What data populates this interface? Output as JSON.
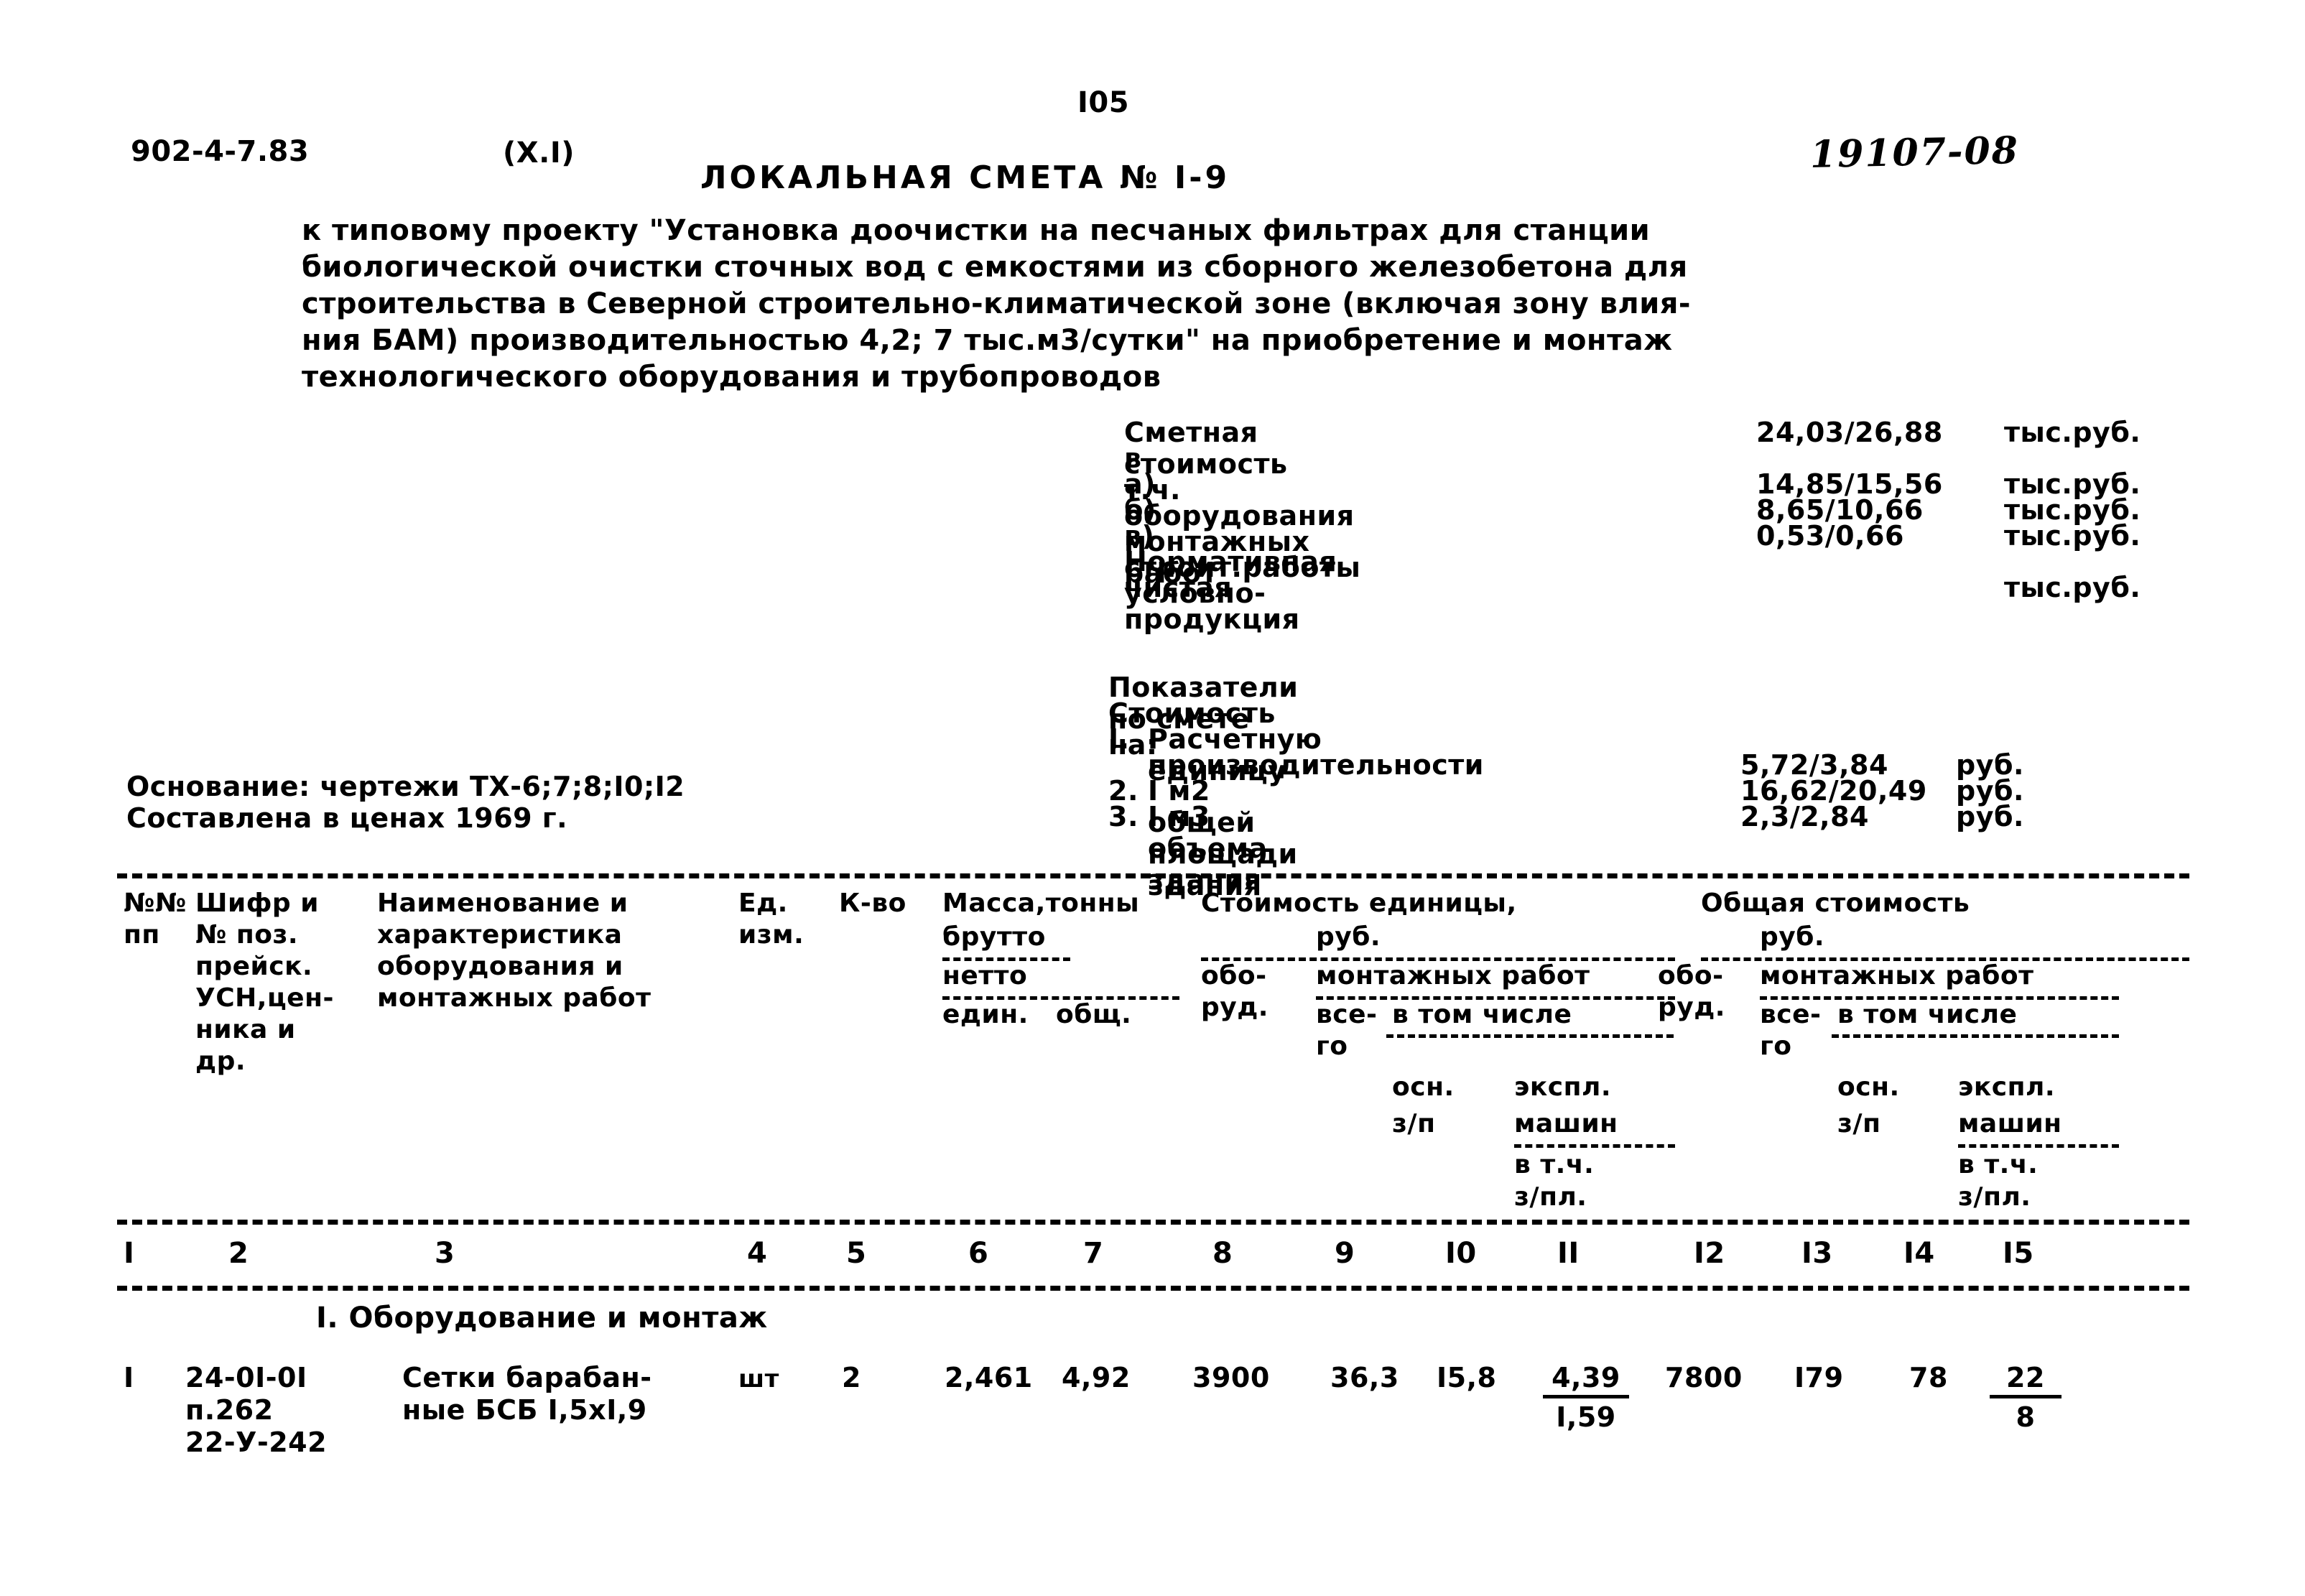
{
  "header": {
    "doc_code": "902-4-7.83",
    "variant": "(X.I)",
    "page_number": "I05",
    "title": "ЛОКАЛЬНАЯ СМЕТА № I-9",
    "archive_code": "19107-08"
  },
  "description": "к типовому проекту \"Установка доочистки на песчаных фильтрах для станции\nбиологической очистки сточных вод с емкостями из сборного железобетона для\nстроительства в Северной строительно-климатической зоне (включая зону влия-\nния БАМ) производительностью 4,2; 7 тыс.м3/сутки\" на приобретение и монтаж\nтехнологического оборудования и трубопроводов",
  "summary": {
    "total_label": "Сметная стоимость",
    "total_value": "24,03/26,88",
    "total_unit": "тыс.руб.",
    "including_label": "в т.ч.",
    "items": [
      {
        "label": "а) оборудования",
        "value": "14,85/15,56",
        "unit": "тыс.руб."
      },
      {
        "label": "б) монтажных работ",
        "value": "8,65/10,66",
        "unit": "тыс.руб."
      },
      {
        "label": "в) строит.работы",
        "value": "0,53/0,66",
        "unit": "тыс.руб."
      }
    ],
    "npp_label_1": "Нормативная условно-",
    "npp_label_2": "чистая продукция",
    "npp_value": "",
    "npp_unit": "тыс.руб."
  },
  "indicators": {
    "heading": "Показатели по смете",
    "subheading": "Стоимость на:",
    "rows": [
      {
        "num": "I.",
        "label": "Расчетную единицу",
        "label2": "производительности",
        "value": "5,72/3,84",
        "unit": "руб."
      },
      {
        "num": "2.",
        "label": "I м2 общей площади здания",
        "label2": "",
        "value": "16,62/20,49",
        "unit": "руб."
      },
      {
        "num": "3.",
        "label": "I м3 объема здания",
        "label2": "",
        "value": "2,3/2,84",
        "unit": "руб."
      }
    ]
  },
  "basis": {
    "line1": "Основание: чертежи ТХ-6;7;8;I0;I2",
    "line2": "Составлена в ценах 1969 г."
  },
  "table": {
    "headers": {
      "c1": "№№\nпп",
      "c2": "Шифр и\n№ поз.\nпрейск.\nУСН,цен-\nника и\nдр.",
      "c3": "Наименование и\nхарактеристика\nоборудования и\nмонтажных работ",
      "c4": "Ед.\nизм.",
      "c5": "К-во",
      "mass_title": "Масса,тонны",
      "mass_brutto": "брутто",
      "mass_netto": "нетто",
      "mass_edin": "един.",
      "mass_obsh": "общ.",
      "unit_cost_title": "Стоимость единицы,",
      "unit_cost_rub": "руб.",
      "unit_cost_oborud": "обо-\nруд.",
      "unit_cost_montazh": "монтажных работ",
      "unit_cost_vsego": "все-\nго",
      "unit_cost_vtomchisle": "в том числе",
      "unit_cost_osn": "осн.",
      "unit_cost_zp": "з/п",
      "unit_cost_ekspl": "экспл.",
      "unit_cost_mashin": "машин",
      "unit_cost_vtch": "в т.ч.",
      "unit_cost_zpl": "з/пл.",
      "total_cost_title": "Общая стоимость",
      "total_cost_rub": "руб.",
      "total_cost_oborud": "обо-\nруд.",
      "total_cost_montazh": "монтажных работ",
      "total_cost_vsego": "все-\nго",
      "total_cost_vtomchisle": "в том числе",
      "total_cost_osn": "осн.",
      "total_cost_zp": "з/п",
      "total_cost_ekspl": "экспл.",
      "total_cost_mashin": "машин",
      "total_cost_vtch": "в т.ч.",
      "total_cost_zpl": "з/пл."
    },
    "column_numbers": [
      "I",
      "2",
      "3",
      "4",
      "5",
      "6",
      "7",
      "8",
      "9",
      "I0",
      "II",
      "I2",
      "I3",
      "I4",
      "I5"
    ],
    "section_title": "I. Оборудование и монтаж",
    "rows": [
      {
        "num": "I",
        "code": "24-0I-0I\nп.262\n22-У-242",
        "name": "Сетки барабан-\nные БСБ I,5xI,9",
        "unit": "шт",
        "qty": "2",
        "mass_edin": "2,461",
        "mass_obsh": "4,92",
        "unit_oborud": "3900",
        "unit_montazh_vsego": "36,3",
        "unit_osn_zp": "I5,8",
        "unit_ekspl_top": "4,39",
        "unit_ekspl_bot": "I,59",
        "total_oborud": "7800",
        "total_montazh_vsego": "I79",
        "total_osn_zp": "78",
        "total_ekspl_top": "22",
        "total_ekspl_bot": "8"
      }
    ]
  }
}
